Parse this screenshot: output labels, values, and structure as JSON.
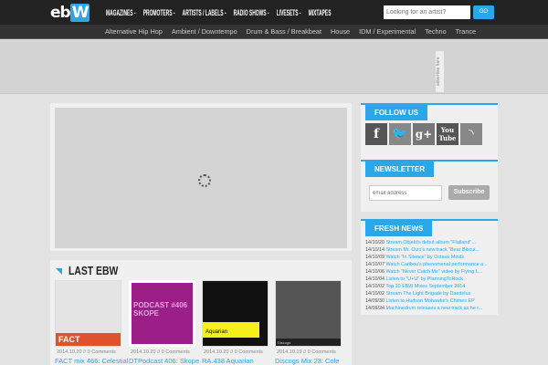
{
  "header": {
    "logo": "eb",
    "logo_accent": "W",
    "nav": [
      "Magazines -",
      "Promoters -",
      "Artists / Labels -",
      "Radio Shows -",
      "Livesets -",
      "Mixtapes"
    ],
    "search_placeholder": "Looking for an artist?",
    "go": "GO"
  },
  "genres": [
    "Alternative Hip Hop",
    "Ambient / Downtempo",
    "Drum & Bass / Breakbeat",
    "House",
    "IDM / Experimental",
    "Techno",
    "Trance"
  ],
  "ad": {
    "label": "advertise here"
  },
  "last_ebw": {
    "title": "LAST EBW",
    "items": [
      {
        "meta": "2014.10.20 // 0 Comments",
        "title": "FACT mix 466: Celestial",
        "thumb": "FACT",
        "color": "#e4e4e4"
      },
      {
        "meta": "2014.10.20 // 0 Comments",
        "title": "DTPodcast 406: Skope",
        "thumb": "PODCAST #406 SKOPE",
        "color": "#9b1f86"
      },
      {
        "meta": "2014.10.20 // 0 Comments",
        "title": "RA.438 Aquarian",
        "thumb": "Aquarian",
        "color": "#111"
      },
      {
        "meta": "2014.10.19 // 0 Comments",
        "title": "Discogs Mix 23: Cole",
        "thumb": "Discogs",
        "color": "#555"
      }
    ]
  },
  "follow": {
    "title": "FOLLOW US",
    "icons": [
      "facebook-icon",
      "twitter-icon",
      "google-plus-icon",
      "youtube-icon",
      "rss-icon"
    ]
  },
  "newsletter": {
    "title": "NEWSLETTER",
    "placeholder": "email address",
    "button": "Subscribe"
  },
  "fresh_news": {
    "title": "FRESH NEWS",
    "items": [
      {
        "date": "14/10/20",
        "text": "Stream Objekt's debut album \"Flatland\"..."
      },
      {
        "date": "14/10/14",
        "text": "Stream Mr. Oizo's new track \"Bear Biscui..."
      },
      {
        "date": "14/10/09",
        "text": "Watch \"In Silence\" by Octave Minds"
      },
      {
        "date": "14/10/07",
        "text": "Watch Caribou's phenomenal performance a..."
      },
      {
        "date": "14/10/06",
        "text": "Watch \"Never Catch Me\" video by Flying L..."
      },
      {
        "date": "14/10/04",
        "text": "Listen to \"U+U\" by PlanningToRock"
      },
      {
        "date": "14/10/02",
        "text": "Top 10 EBW Mixes September 2014"
      },
      {
        "date": "14/10/02",
        "text": "Stream The Light Brigade by Daedelus"
      },
      {
        "date": "14/09/30",
        "text": "Listen to Hudson Mohawke's Chimes EP"
      },
      {
        "date": "14/09/24",
        "text": "Machinedrum releases a new track as he r..."
      }
    ]
  }
}
